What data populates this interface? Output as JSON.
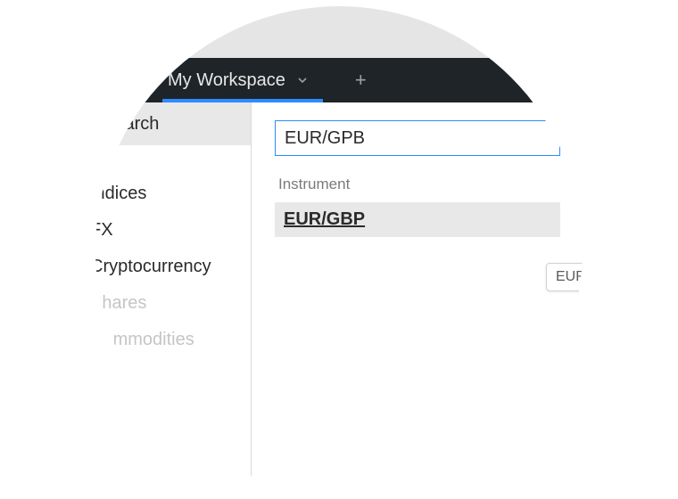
{
  "header": {
    "workspace_tab": "My Workspace",
    "add_tab": "+"
  },
  "sidebar": {
    "search_label": "Search",
    "categories": [
      {
        "label": "Indices",
        "faded": false
      },
      {
        "label": "FX",
        "faded": false
      },
      {
        "label": "Cryptocurrency",
        "faded": false
      },
      {
        "label": "Shares",
        "faded": true
      },
      {
        "label": "Commodities",
        "faded": true
      }
    ]
  },
  "content": {
    "input_value": "EUR/GPB",
    "section_label": "Instrument",
    "result": "EUR/GBP",
    "tooltip": "EUR"
  }
}
